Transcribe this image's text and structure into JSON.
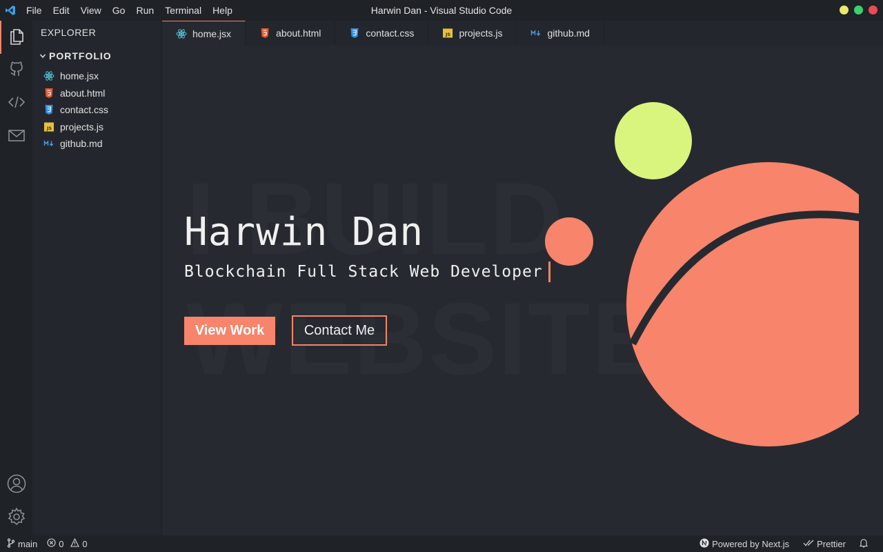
{
  "window": {
    "title": "Harwin Dan - Visual Studio Code",
    "traffic_colors": [
      "#e9e96a",
      "#38d16a",
      "#ec4a55"
    ]
  },
  "menu": [
    {
      "label": "File"
    },
    {
      "label": "Edit"
    },
    {
      "label": "View"
    },
    {
      "label": "Go"
    },
    {
      "label": "Run"
    },
    {
      "label": "Terminal"
    },
    {
      "label": "Help"
    }
  ],
  "activity": {
    "top": [
      "files-icon",
      "github-icon",
      "code-icon",
      "mail-icon"
    ],
    "bottom": [
      "account-icon",
      "settings-icon"
    ],
    "accent": "#f7846b"
  },
  "sidebar": {
    "title": "EXPLORER",
    "folder": "PORTFOLIO",
    "files": [
      {
        "name": "home.jsx",
        "icon": "react-icon"
      },
      {
        "name": "about.html",
        "icon": "html-icon"
      },
      {
        "name": "contact.css",
        "icon": "css-icon"
      },
      {
        "name": "projects.js",
        "icon": "js-icon"
      },
      {
        "name": "github.md",
        "icon": "markdown-icon"
      }
    ]
  },
  "tabs": [
    {
      "label": "home.jsx",
      "icon": "react-icon",
      "active": true
    },
    {
      "label": "about.html",
      "icon": "html-icon",
      "active": false
    },
    {
      "label": "contact.css",
      "icon": "css-icon",
      "active": false
    },
    {
      "label": "projects.js",
      "icon": "js-icon",
      "active": false
    },
    {
      "label": "github.md",
      "icon": "markdown-icon",
      "active": false
    }
  ],
  "hero": {
    "background_text_1": "I BUILD",
    "background_text_2": "WEBSITES",
    "name": "Harwin Dan",
    "subtitle": "Blockchain Full Stack Web Developer",
    "primary_button": "View Work",
    "secondary_button": "Contact Me",
    "colors": {
      "coral": "#f7846b",
      "lime": "#d9f57e"
    }
  },
  "statusbar": {
    "branch": "main",
    "errors": "0",
    "warnings": "0",
    "powered_by": "Powered by Next.js",
    "formatter": "Prettier"
  }
}
